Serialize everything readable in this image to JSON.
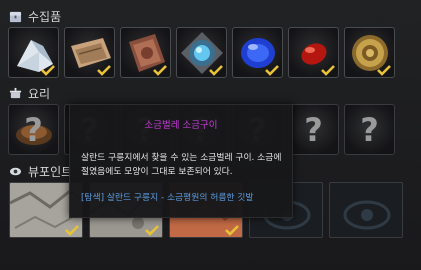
{
  "sections": {
    "collection": {
      "title": "수집품",
      "icon": "treasure-chest-icon"
    },
    "cooking": {
      "title": "요리",
      "icon": "cooking-pot-icon"
    },
    "viewpoint": {
      "title": "뷰포인트",
      "icon": "eye-icon"
    }
  },
  "collection_items": [
    {
      "icon": "salt-crystal-icon",
      "collected": true
    },
    {
      "icon": "old-map-scroll-icon",
      "collected": true
    },
    {
      "icon": "leather-book-icon",
      "collected": true
    },
    {
      "icon": "blue-gem-amulet-icon",
      "collected": true
    },
    {
      "icon": "sapphire-gem-icon",
      "collected": true
    },
    {
      "icon": "red-ruby-icon",
      "collected": true
    },
    {
      "icon": "golden-coin-icon",
      "collected": true
    }
  ],
  "cooking_items": [
    {
      "icon": "grilled-food-icon",
      "collected": false
    },
    {
      "icon": "unknown-question-icon",
      "collected": false
    },
    {
      "icon": "unknown-question-icon",
      "collected": false
    },
    {
      "icon": "unknown-question-icon",
      "collected": false
    },
    {
      "icon": "unknown-question-icon",
      "collected": false
    },
    {
      "icon": "unknown-question-icon",
      "collected": false
    },
    {
      "icon": "unknown-question-icon",
      "collected": false
    }
  ],
  "question_mark": "?",
  "tooltip": {
    "title": "소금벌레 소금구이",
    "description": "살란드 구릉지에서 찾을 수 있는 소금벌레 구이. 소금에 절였음에도 모양이 그대로 보존되어 있다.",
    "location": "[탐색] 살란드 구릉지 - 소금평원의 허름한 깃발"
  },
  "viewpoint_items": [
    {
      "icon": "map-view-icon",
      "collected": true
    },
    {
      "icon": "map-view-icon",
      "collected": true
    },
    {
      "icon": "red-landscape-icon",
      "collected": true
    },
    {
      "icon": "eye-locked-icon",
      "collected": false
    },
    {
      "icon": "eye-locked-icon",
      "collected": false
    }
  ],
  "colors": {
    "accent_check": "#e8c238",
    "tooltip_title": "#c33bd6",
    "tooltip_location": "#5b9ce0"
  }
}
